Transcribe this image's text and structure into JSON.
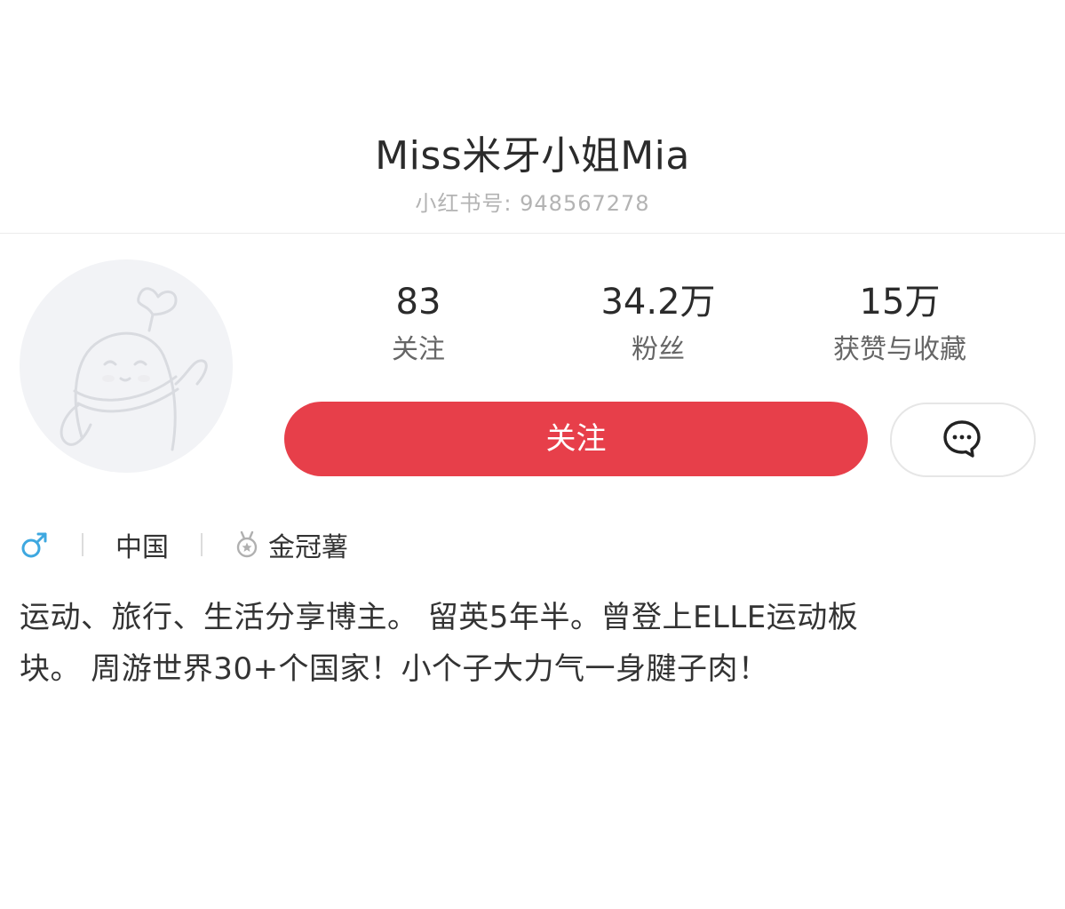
{
  "profile": {
    "name": "Miss米牙小姐Mia",
    "id_text": "小红书号: 948567278"
  },
  "stats": [
    {
      "value": "83",
      "label": "关注"
    },
    {
      "value": "34.2万",
      "label": "粉丝"
    },
    {
      "value": "15万",
      "label": "获赞与收藏"
    }
  ],
  "actions": {
    "follow_label": "关注",
    "message_icon": "chat-bubble-icon"
  },
  "meta": {
    "gender": "male",
    "location": "中国",
    "level": "金冠薯"
  },
  "bio": {
    "line1": "运动、旅行、生活分享博主。 留英5年半。曾登上ELLE运动板",
    "line2": "块。 周游世界30+个国家！小个子大力气一身腱子肉！"
  },
  "colors": {
    "accent": "#e73f4a",
    "gender_icon": "#3ea8e0",
    "muted_text": "#b3b3b3"
  }
}
